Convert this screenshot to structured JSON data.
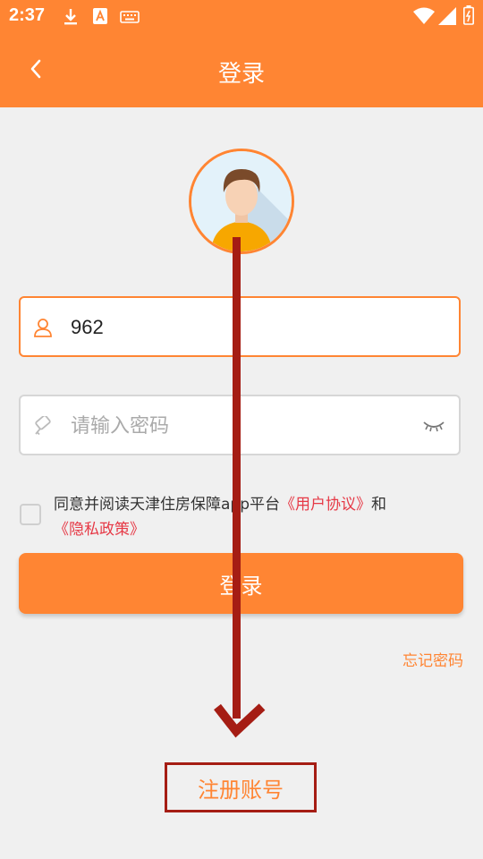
{
  "status_bar": {
    "time": "2:37"
  },
  "header": {
    "title": "登录"
  },
  "login": {
    "username_value": "962",
    "password_placeholder": "请输入密码"
  },
  "agreement": {
    "prefix": "同意并阅读天津住房保障app平台",
    "user_agreement_link": "《用户协议》",
    "and": "和",
    "privacy_link": "《隐私政策》"
  },
  "buttons": {
    "login_label": "登录",
    "forgot_label": "忘记密码",
    "register_label": "注册账号"
  },
  "colors": {
    "primary": "#ff8533",
    "link": "#e63946",
    "annotation": "#a51d14"
  },
  "icons": [
    "download-icon",
    "font-icon",
    "keyboard-icon",
    "wifi-icon",
    "signal-icon",
    "battery-icon",
    "back-icon",
    "user-icon",
    "key-icon",
    "eye-closed-icon"
  ]
}
